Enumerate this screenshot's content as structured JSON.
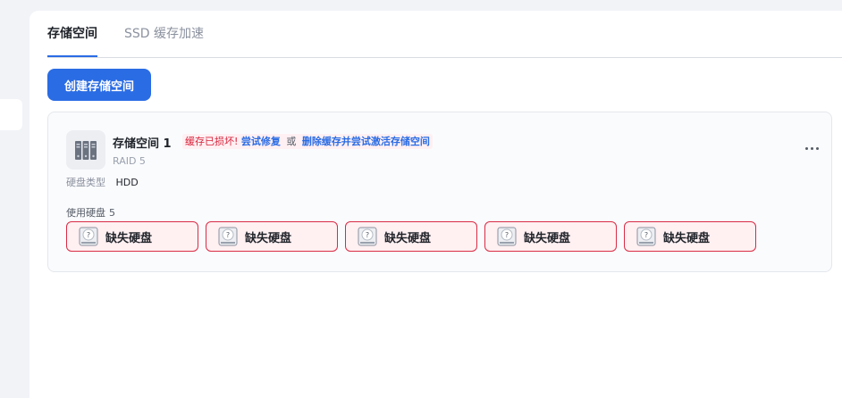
{
  "tabs": [
    {
      "label": "存储空间",
      "active": true
    },
    {
      "label": "SSD 缓存加速",
      "active": false
    }
  ],
  "create_button": "创建存储空间",
  "volume": {
    "name": "存储空间 1",
    "alert": {
      "error_text": "缓存已损坏!",
      "link_repair": "尝试修复",
      "or_text": "或",
      "link_delete": "删除缓存并尝试激活存储空间"
    },
    "raid": "RAID 5",
    "disk_type_label": "硬盘类型",
    "disk_type_value": "HDD",
    "used_disks_label": "使用硬盘",
    "used_disks_count": "5",
    "disks": [
      {
        "label": "缺失硬盘"
      },
      {
        "label": "缺失硬盘"
      },
      {
        "label": "缺失硬盘"
      },
      {
        "label": "缺失硬盘"
      },
      {
        "label": "缺失硬盘"
      }
    ]
  },
  "colors": {
    "accent": "#2a6ce4",
    "error": "#d6223a",
    "error_bg": "#fff0f2"
  }
}
